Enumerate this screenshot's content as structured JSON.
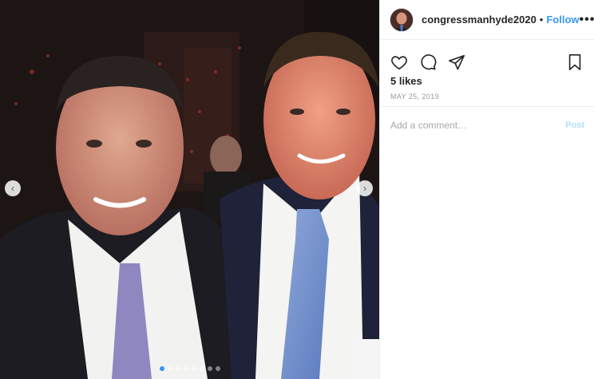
{
  "post": {
    "username": "congressmanhyde2020",
    "separator": "•",
    "follow_label": "Follow",
    "more_label": "•••",
    "likes": "5 likes",
    "date": "MAY 25, 2019"
  },
  "comment": {
    "placeholder": "Add a comment…",
    "post_label": "Post"
  },
  "carousel": {
    "slide_count": 8,
    "active_slide": 1,
    "prev_glyph": "‹",
    "next_glyph": "›"
  },
  "icons": {
    "like": "heart-icon",
    "comment": "comment-icon",
    "share": "share-icon",
    "save": "bookmark-icon"
  },
  "colors": {
    "accent": "#3897f0",
    "post_disabled": "#b2dffc",
    "meta_text": "#999999"
  }
}
